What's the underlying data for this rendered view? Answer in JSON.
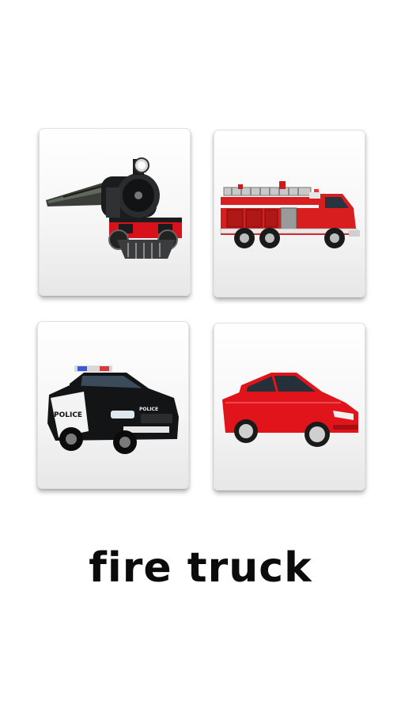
{
  "cards": [
    {
      "icon": "steam-train-icon",
      "position": "top-left"
    },
    {
      "icon": "fire-truck-icon",
      "position": "top-right"
    },
    {
      "icon": "police-car-icon",
      "position": "bottom-left"
    },
    {
      "icon": "red-car-icon",
      "position": "bottom-right"
    }
  ],
  "prompt": {
    "word": "fire truck"
  },
  "police_car": {
    "door_text": "POLICE",
    "hood_text": "POLICE"
  },
  "colors": {
    "fire_red": "#d81e1e",
    "car_red": "#e0141a",
    "police_black": "#121416",
    "train_black": "#1b1c1e"
  }
}
